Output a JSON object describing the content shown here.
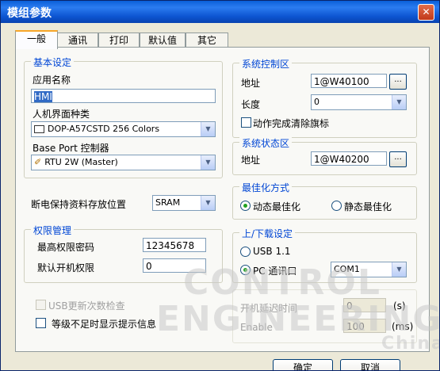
{
  "window": {
    "title": "模组参数",
    "close": "✕"
  },
  "tabs": [
    "一般",
    "通讯",
    "打印",
    "默认值",
    "其它"
  ],
  "basic": {
    "group": "基本设定",
    "app_name_label": "应用名称",
    "app_name_value": "HMI",
    "hmi_type_label": "人机界面种类",
    "hmi_type_value": "DOP-A57CSTD 256 Colors",
    "base_port_label": "Base Port 控制器",
    "base_port_value": "RTU 2W (Master)"
  },
  "power": {
    "label": "断电保持资料存放位置",
    "value": "SRAM"
  },
  "perm": {
    "group": "权限管理",
    "pwd_label": "最高权限密码",
    "pwd_value": "12345678",
    "default_label": "默认开机权限",
    "default_value": "0"
  },
  "usb_check": "USB更新次数检查",
  "warn_check": "等级不足时显示提示信息",
  "sys_ctrl": {
    "group": "系统控制区",
    "addr_label": "地址",
    "addr_value": "1@W40100",
    "len_label": "长度",
    "len_value": "0",
    "clear_label": "动作完成清除旗标",
    "browse": "..."
  },
  "sys_status": {
    "group": "系统状态区",
    "addr_label": "地址",
    "addr_value": "1@W40200",
    "browse": "..."
  },
  "optimize": {
    "group": "最佳化方式",
    "dynamic": "动态最佳化",
    "static": "静态最佳化"
  },
  "updown": {
    "group": "上/下载设定",
    "usb": "USB 1.1",
    "pc": "PC 通讯口",
    "port_value": "COM1"
  },
  "startup": {
    "delay_label": "开机延迟时间",
    "delay_value": "0",
    "delay_unit": "(s)",
    "enable_label": "Enable",
    "enable_value": "100",
    "enable_unit": "(ms)"
  },
  "buttons": {
    "ok": "确定",
    "cancel": "取消"
  },
  "watermark": {
    "line1": "CONTROL",
    "line2": "ENGINEERING",
    "line3": "China"
  }
}
